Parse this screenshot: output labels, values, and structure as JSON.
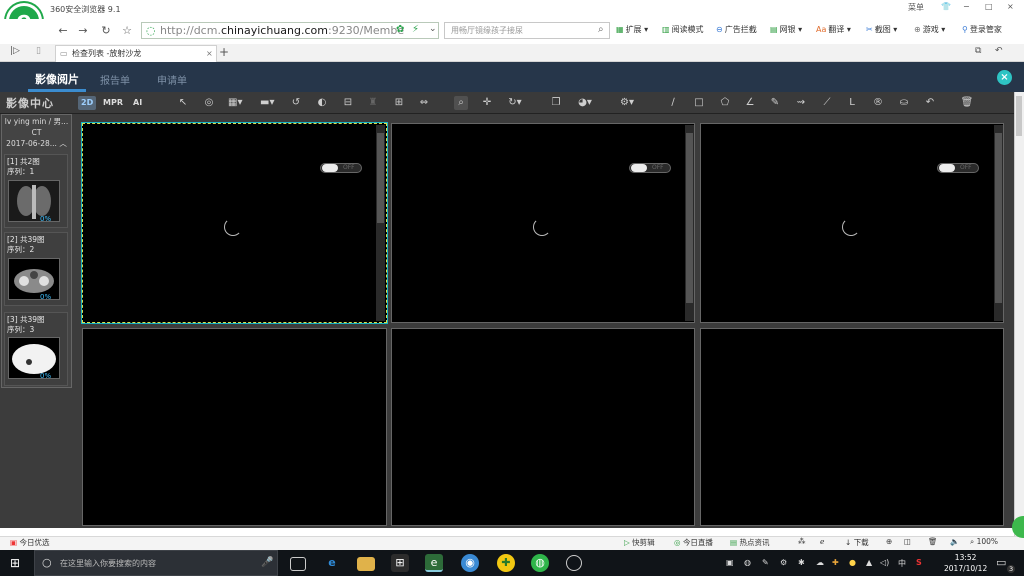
{
  "browser": {
    "title": "360安全浏览器 9.1",
    "window_controls": [
      "菜单",
      "−",
      "□",
      "×"
    ],
    "url_prefix": "http://dcm.",
    "url_domain": "chinayichuang.com",
    "url_suffix": ":9230/Membe",
    "search_placeholder": "用畅厅镜缘孩子接尿",
    "toolbar_items": [
      "扩展",
      "阅读模式",
      "广告拦截",
      "网银",
      "翻译",
      "截图",
      "游戏",
      "登录管家"
    ],
    "tab_title": "检查列表 -放射沙龙",
    "new_tab": "+"
  },
  "app": {
    "tabs": [
      "影像阅片",
      "报告单",
      "申请单"
    ],
    "active_tab": "影像阅片",
    "brand_calligraphy": "影像中心",
    "modes": [
      "2D",
      "MPR",
      "AI"
    ],
    "active_mode": "2D"
  },
  "patient": {
    "name": "lv ying min / 男...",
    "modality": "CT",
    "date": "2017-06-28..."
  },
  "series": [
    {
      "label": "[1] 共2图",
      "seq": "序列：1",
      "progress": "0%"
    },
    {
      "label": "[2] 共39图",
      "seq": "序列：2",
      "progress": "0%"
    },
    {
      "label": "[3] 共39图",
      "seq": "序列：3",
      "progress": "0%"
    }
  ],
  "viewports": {
    "toggle_label": "OFF"
  },
  "statusbar": {
    "left": "今日优选",
    "items": [
      "快剪辑",
      "今日直播",
      "热点资讯",
      "下载",
      "100%"
    ]
  },
  "taskbar": {
    "search_placeholder": "在这里输入你要搜索的内容",
    "time": "13:52",
    "date": "2017/10/12",
    "ime": "中",
    "notification_count": "3"
  },
  "colors": {
    "app_header": "#26364a",
    "toolbar": "#3a3a3a",
    "active_viewport_border": "#d7e34e",
    "accent_cyan": "#2ec4c4",
    "browser_green": "#1fa84a"
  }
}
